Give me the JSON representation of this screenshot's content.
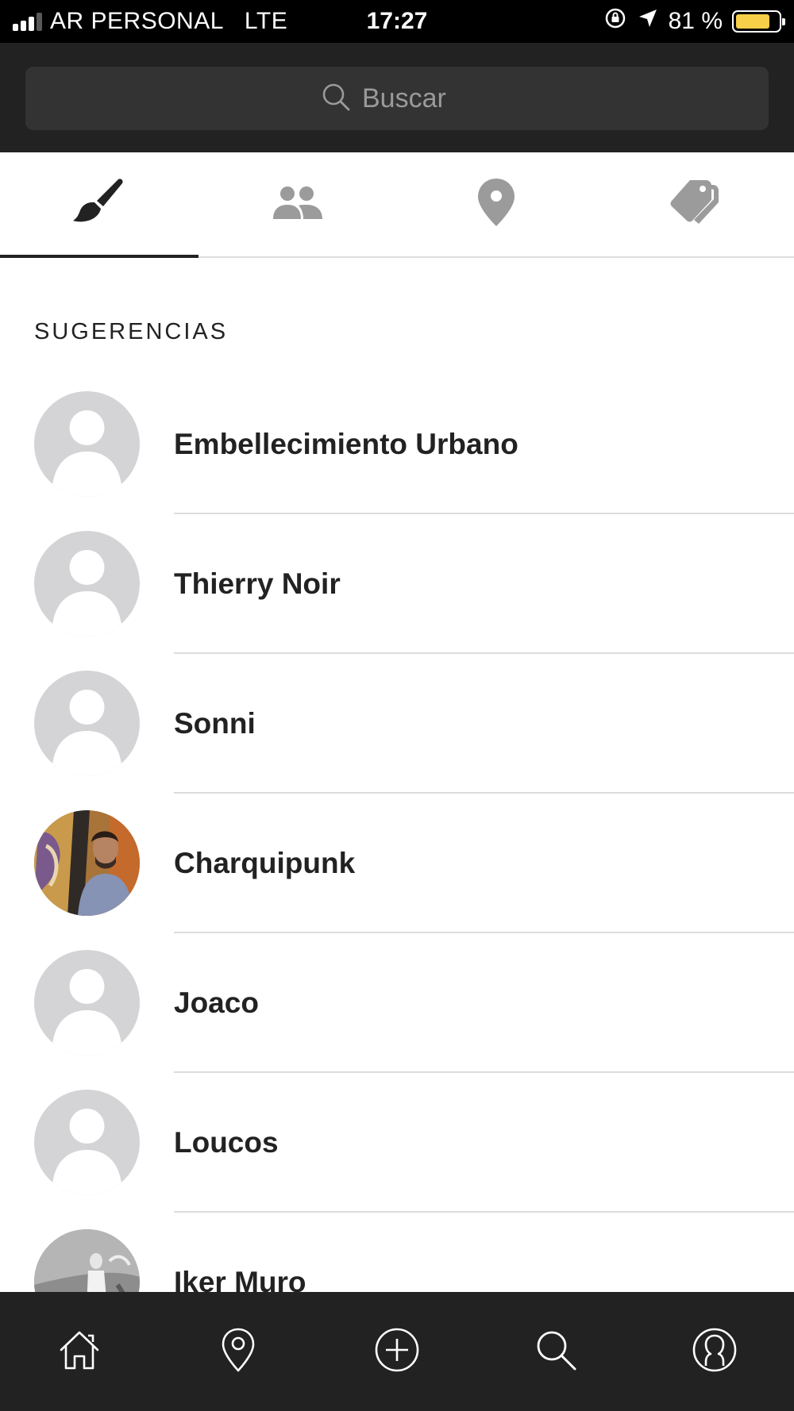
{
  "status_bar": {
    "carrier": "AR PERSONAL",
    "network": "LTE",
    "time": "17:27",
    "battery_percent": "81 %",
    "battery_level": 0.81,
    "battery_color": "#f8cf48",
    "icons": [
      "signal-icon",
      "rotation-lock-icon",
      "location-arrow-icon",
      "battery-icon"
    ]
  },
  "search": {
    "placeholder": "Buscar",
    "icon": "search-icon"
  },
  "tabs": [
    {
      "icon": "paintbrush-icon",
      "active": true
    },
    {
      "icon": "users-icon",
      "active": false
    },
    {
      "icon": "map-pin-icon",
      "active": false
    },
    {
      "icon": "tags-icon",
      "active": false
    }
  ],
  "section": {
    "title": "SUGERENCIAS"
  },
  "suggestions": [
    {
      "name": "Embellecimiento Urbano",
      "avatar": "default-avatar-icon"
    },
    {
      "name": "Thierry Noir",
      "avatar": "default-avatar-icon"
    },
    {
      "name": "Sonni",
      "avatar": "default-avatar-icon"
    },
    {
      "name": "Charquipunk",
      "avatar": "user-photo"
    },
    {
      "name": "Joaco",
      "avatar": "default-avatar-icon"
    },
    {
      "name": "Loucos",
      "avatar": "default-avatar-icon"
    },
    {
      "name": "Iker Muro",
      "avatar": "user-photo"
    }
  ],
  "bottom_nav": [
    {
      "icon": "home-icon"
    },
    {
      "icon": "location-icon"
    },
    {
      "icon": "add-circle-icon"
    },
    {
      "icon": "search-icon",
      "active": true
    },
    {
      "icon": "profile-icon"
    }
  ],
  "colors": {
    "header_bg": "#222222",
    "search_bg": "#333333",
    "tab_active": "#222222",
    "tab_inactive": "#9b9b9b",
    "avatar_placeholder": "#d4d4d6"
  }
}
